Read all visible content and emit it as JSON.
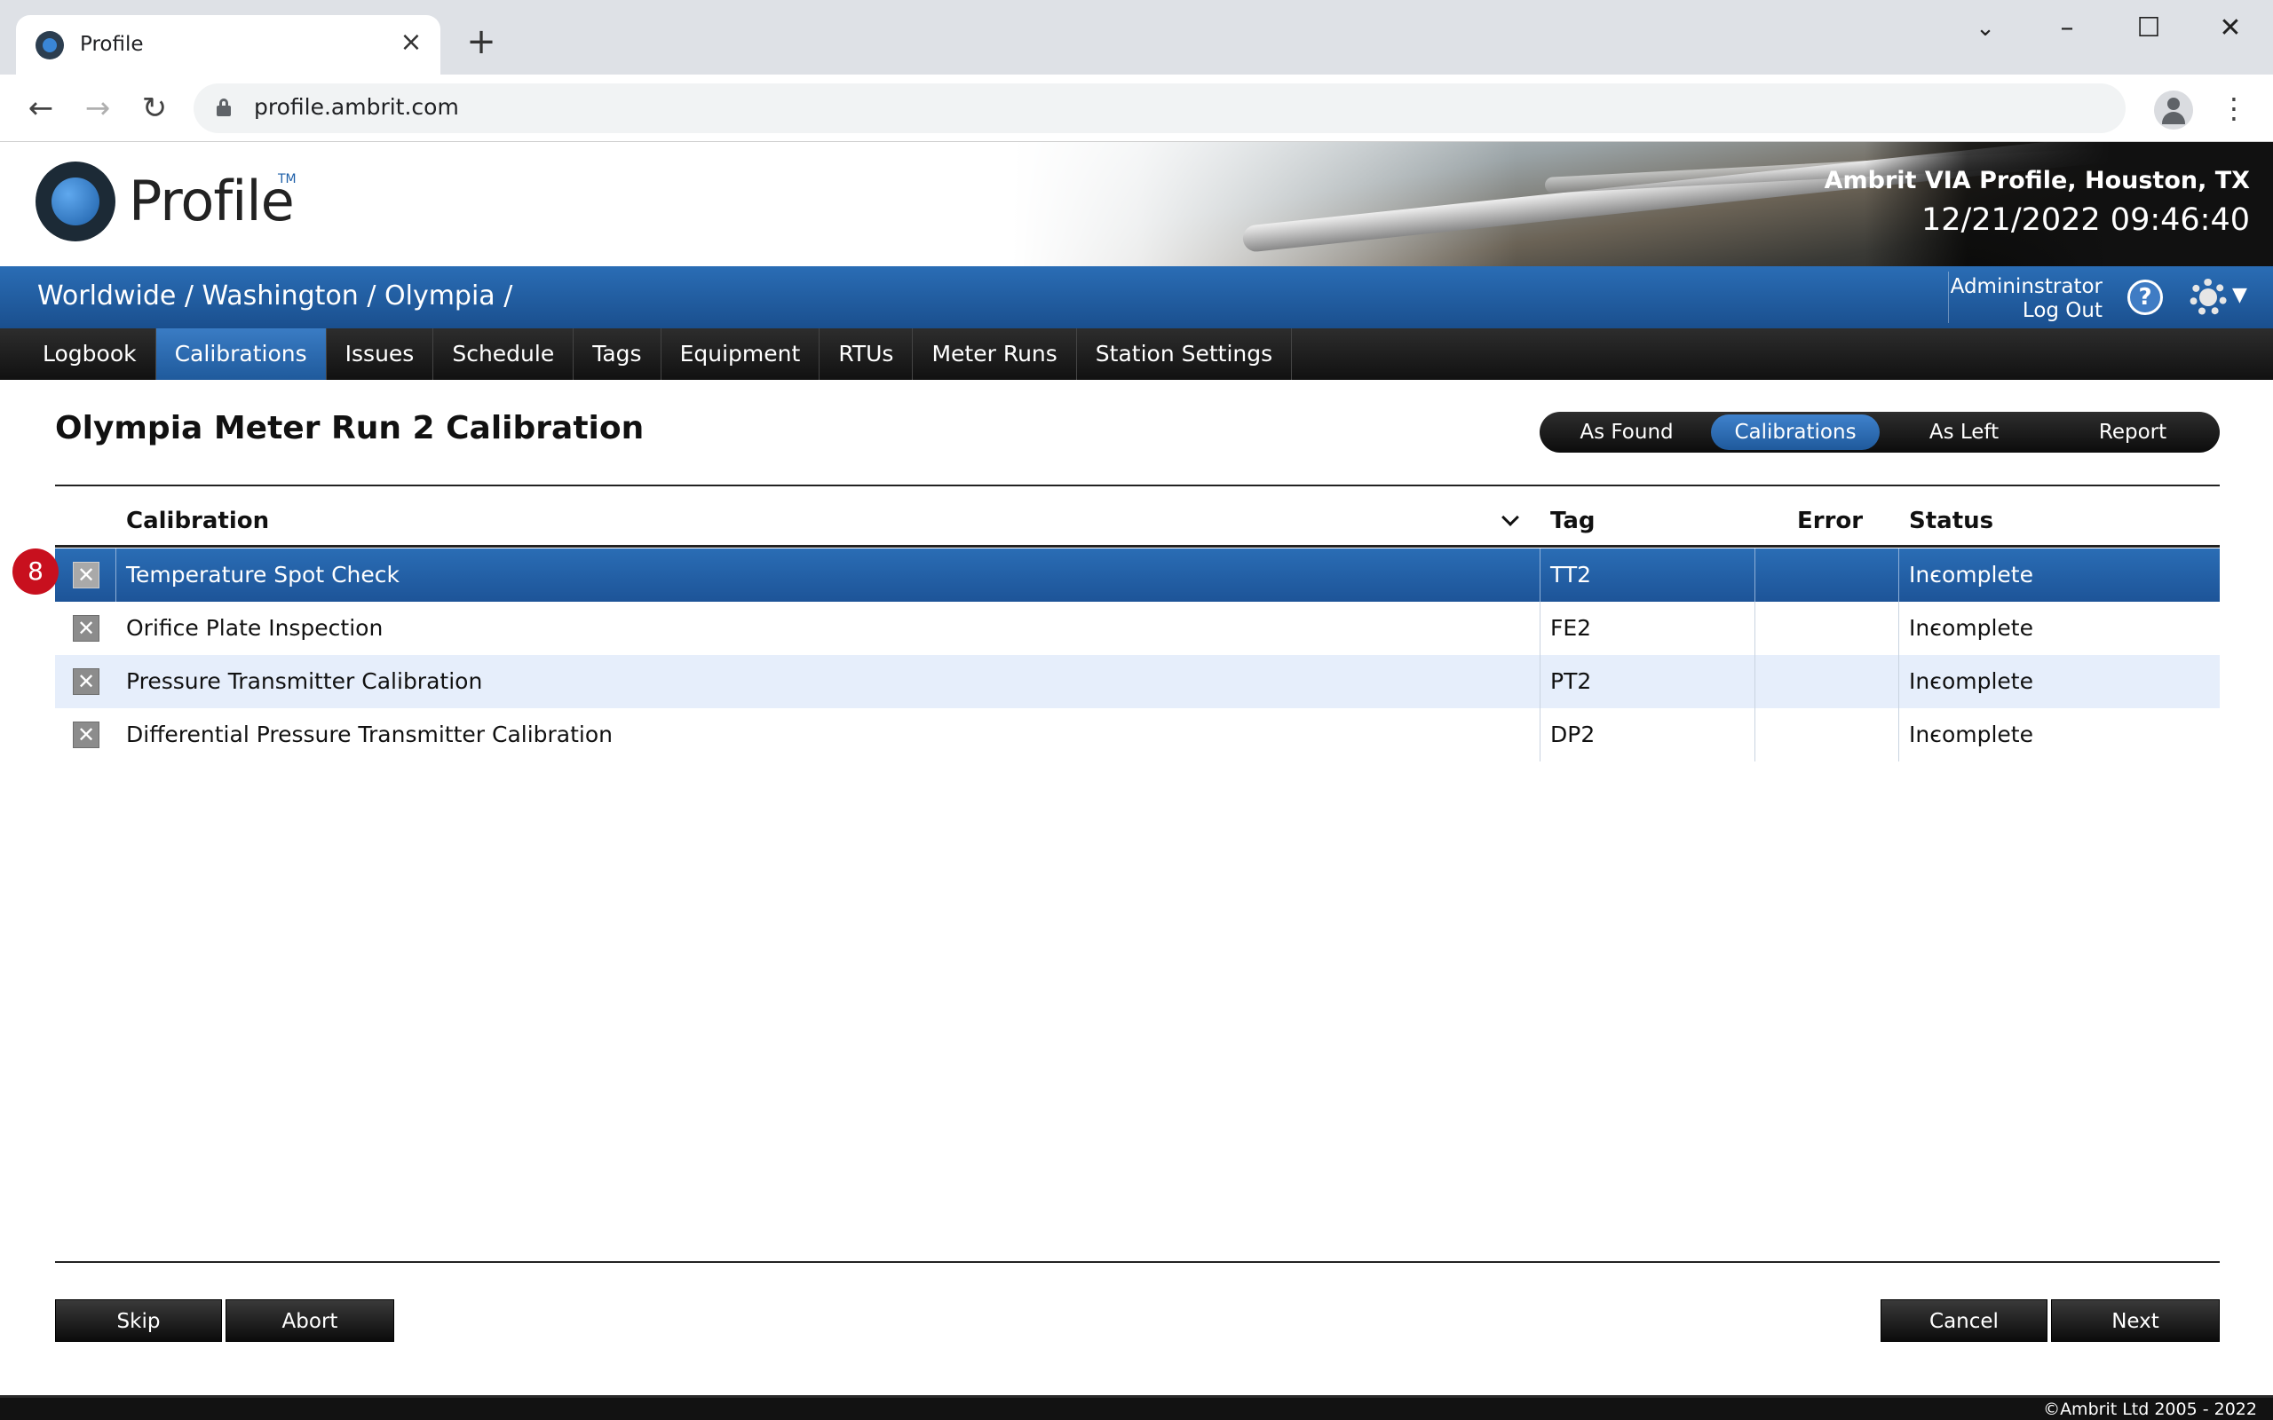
{
  "browser": {
    "tab_title": "Profile",
    "url": "profile.ambrit.com",
    "icons": {
      "close": "close-tab-icon",
      "new_tab": "plus-icon",
      "back": "arrow-left-icon",
      "forward": "arrow-right-icon",
      "reload": "reload-icon"
    }
  },
  "banner": {
    "logo_text": "Profile",
    "logo_tm": "TM",
    "site_name": "Ambrit VIA Profile, Houston, TX",
    "datetime": "12/21/2022 09:46:40"
  },
  "breadcrumb": "Worldwide / Washington / Olympia /",
  "user": {
    "name": "Admininstrator",
    "logout": "Log Out"
  },
  "nav": {
    "items": [
      "Logbook",
      "Calibrations",
      "Issues",
      "Schedule",
      "Tags",
      "Equipment",
      "RTUs",
      "Meter Runs",
      "Station Settings"
    ],
    "active": "Calibrations"
  },
  "page": {
    "title": "Olympia Meter Run 2 Calibration",
    "steps": [
      "As Found",
      "Calibrations",
      "As Left",
      "Report"
    ],
    "active_step": "Calibrations"
  },
  "table": {
    "columns": {
      "calibration": "Calibration",
      "tag": "Tag",
      "error": "Error",
      "status": "Status"
    },
    "rows": [
      {
        "calibration": "Temperature Spot Check",
        "tag": "TT2",
        "error": "-",
        "status": "Incomplete"
      },
      {
        "calibration": "Orifice Plate Inspection",
        "tag": "FE2",
        "error": "-",
        "status": "Incomplete"
      },
      {
        "calibration": "Pressure Transmitter Calibration",
        "tag": "PT2",
        "error": "-",
        "status": "Incomplete"
      },
      {
        "calibration": "Differential Pressure Transmitter Calibration",
        "tag": "DP2",
        "error": "-",
        "status": "Incomplete"
      }
    ],
    "selected_row": 0,
    "step_badge": "8"
  },
  "buttons": {
    "skip": "Skip",
    "abort": "Abort",
    "cancel": "Cancel",
    "next": "Next"
  },
  "footer": {
    "copyright": "©Ambrit Ltd 2005 - 2022"
  },
  "colors": {
    "accent_blue": "#1f5a9c",
    "selected_row": "#2a6db5",
    "alt_row": "#e6eefb",
    "badge_red": "#c8101e"
  }
}
